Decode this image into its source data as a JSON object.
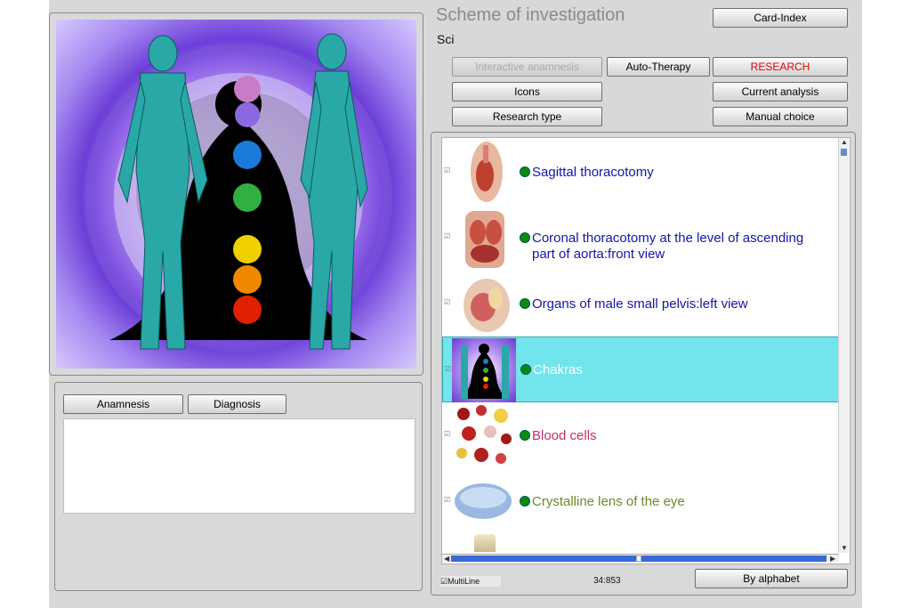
{
  "header": {
    "title": "Scheme of investigation",
    "subtitle": "Sci"
  },
  "buttons": {
    "card_index": "Card-Index",
    "interactive_anamnesis": "Interactive anamnesis",
    "auto_therapy": "Auto-Therapy",
    "research": "RESEARCH",
    "icons": "Icons",
    "current_analysis": "Current analysis",
    "research_type": "Research type",
    "manual_choice": "Manual choice",
    "anamnesis": "Anamnesis",
    "diagnosis": "Diagnosis",
    "by_alphabet": "By alphabet"
  },
  "list": {
    "items": [
      {
        "label_line1": "Sagittal thoracotomy",
        "label_line2": "",
        "color": "#1515a8",
        "thumb": "sagittal-thoracotomy-thumb",
        "checked": true,
        "selected": false
      },
      {
        "label_line1": "Coronal thoracotomy at the level of ascending",
        "label_line2": "part of aorta:front view",
        "color": "#1515a8",
        "thumb": "coronal-thoracotomy-thumb",
        "checked": true,
        "selected": false
      },
      {
        "label_line1": "Organs of male small pelvis:left view",
        "label_line2": "",
        "color": "#1515a8",
        "thumb": "male-pelvis-thumb",
        "checked": true,
        "selected": false
      },
      {
        "label_line1": "Chakras",
        "label_line2": "",
        "color": "#ffffff",
        "thumb": "chakras-thumb",
        "checked": true,
        "selected": true
      },
      {
        "label_line1": "Blood cells",
        "label_line2": "",
        "color": "#c0306a",
        "thumb": "blood-cells-thumb",
        "checked": true,
        "selected": false
      },
      {
        "label_line1": "Crystalline lens of the eye",
        "label_line2": "",
        "color": "#6a8a2a",
        "thumb": "eye-lens-thumb",
        "checked": true,
        "selected": false
      }
    ]
  },
  "footer": {
    "multiline_label": "MultiLine",
    "multiline_checked": true,
    "counter": "34:853"
  },
  "colors": {
    "selection": "#72e4ec",
    "dot": "#0a8a0a",
    "research_text": "#e00000"
  }
}
